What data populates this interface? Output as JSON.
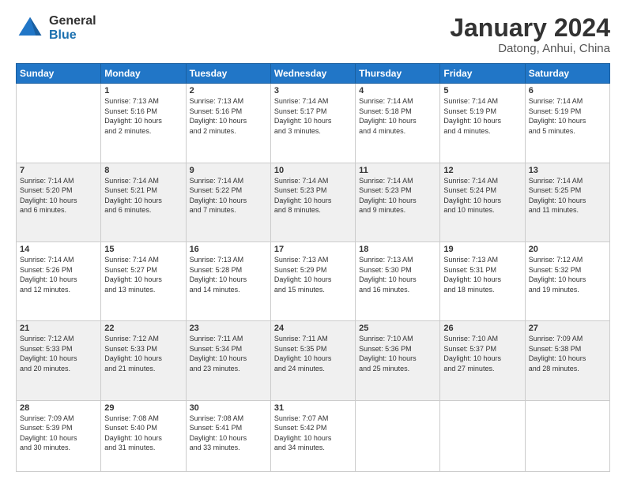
{
  "logo": {
    "general": "General",
    "blue": "Blue"
  },
  "title": {
    "month": "January 2024",
    "location": "Datong, Anhui, China"
  },
  "weekdays": [
    "Sunday",
    "Monday",
    "Tuesday",
    "Wednesday",
    "Thursday",
    "Friday",
    "Saturday"
  ],
  "weeks": [
    [
      {
        "day": "",
        "info": ""
      },
      {
        "day": "1",
        "info": "Sunrise: 7:13 AM\nSunset: 5:16 PM\nDaylight: 10 hours\nand 2 minutes."
      },
      {
        "day": "2",
        "info": "Sunrise: 7:13 AM\nSunset: 5:16 PM\nDaylight: 10 hours\nand 2 minutes."
      },
      {
        "day": "3",
        "info": "Sunrise: 7:14 AM\nSunset: 5:17 PM\nDaylight: 10 hours\nand 3 minutes."
      },
      {
        "day": "4",
        "info": "Sunrise: 7:14 AM\nSunset: 5:18 PM\nDaylight: 10 hours\nand 4 minutes."
      },
      {
        "day": "5",
        "info": "Sunrise: 7:14 AM\nSunset: 5:19 PM\nDaylight: 10 hours\nand 4 minutes."
      },
      {
        "day": "6",
        "info": "Sunrise: 7:14 AM\nSunset: 5:19 PM\nDaylight: 10 hours\nand 5 minutes."
      }
    ],
    [
      {
        "day": "7",
        "info": "Sunrise: 7:14 AM\nSunset: 5:20 PM\nDaylight: 10 hours\nand 6 minutes."
      },
      {
        "day": "8",
        "info": "Sunrise: 7:14 AM\nSunset: 5:21 PM\nDaylight: 10 hours\nand 6 minutes."
      },
      {
        "day": "9",
        "info": "Sunrise: 7:14 AM\nSunset: 5:22 PM\nDaylight: 10 hours\nand 7 minutes."
      },
      {
        "day": "10",
        "info": "Sunrise: 7:14 AM\nSunset: 5:23 PM\nDaylight: 10 hours\nand 8 minutes."
      },
      {
        "day": "11",
        "info": "Sunrise: 7:14 AM\nSunset: 5:23 PM\nDaylight: 10 hours\nand 9 minutes."
      },
      {
        "day": "12",
        "info": "Sunrise: 7:14 AM\nSunset: 5:24 PM\nDaylight: 10 hours\nand 10 minutes."
      },
      {
        "day": "13",
        "info": "Sunrise: 7:14 AM\nSunset: 5:25 PM\nDaylight: 10 hours\nand 11 minutes."
      }
    ],
    [
      {
        "day": "14",
        "info": "Sunrise: 7:14 AM\nSunset: 5:26 PM\nDaylight: 10 hours\nand 12 minutes."
      },
      {
        "day": "15",
        "info": "Sunrise: 7:14 AM\nSunset: 5:27 PM\nDaylight: 10 hours\nand 13 minutes."
      },
      {
        "day": "16",
        "info": "Sunrise: 7:13 AM\nSunset: 5:28 PM\nDaylight: 10 hours\nand 14 minutes."
      },
      {
        "day": "17",
        "info": "Sunrise: 7:13 AM\nSunset: 5:29 PM\nDaylight: 10 hours\nand 15 minutes."
      },
      {
        "day": "18",
        "info": "Sunrise: 7:13 AM\nSunset: 5:30 PM\nDaylight: 10 hours\nand 16 minutes."
      },
      {
        "day": "19",
        "info": "Sunrise: 7:13 AM\nSunset: 5:31 PM\nDaylight: 10 hours\nand 18 minutes."
      },
      {
        "day": "20",
        "info": "Sunrise: 7:12 AM\nSunset: 5:32 PM\nDaylight: 10 hours\nand 19 minutes."
      }
    ],
    [
      {
        "day": "21",
        "info": "Sunrise: 7:12 AM\nSunset: 5:33 PM\nDaylight: 10 hours\nand 20 minutes."
      },
      {
        "day": "22",
        "info": "Sunrise: 7:12 AM\nSunset: 5:33 PM\nDaylight: 10 hours\nand 21 minutes."
      },
      {
        "day": "23",
        "info": "Sunrise: 7:11 AM\nSunset: 5:34 PM\nDaylight: 10 hours\nand 23 minutes."
      },
      {
        "day": "24",
        "info": "Sunrise: 7:11 AM\nSunset: 5:35 PM\nDaylight: 10 hours\nand 24 minutes."
      },
      {
        "day": "25",
        "info": "Sunrise: 7:10 AM\nSunset: 5:36 PM\nDaylight: 10 hours\nand 25 minutes."
      },
      {
        "day": "26",
        "info": "Sunrise: 7:10 AM\nSunset: 5:37 PM\nDaylight: 10 hours\nand 27 minutes."
      },
      {
        "day": "27",
        "info": "Sunrise: 7:09 AM\nSunset: 5:38 PM\nDaylight: 10 hours\nand 28 minutes."
      }
    ],
    [
      {
        "day": "28",
        "info": "Sunrise: 7:09 AM\nSunset: 5:39 PM\nDaylight: 10 hours\nand 30 minutes."
      },
      {
        "day": "29",
        "info": "Sunrise: 7:08 AM\nSunset: 5:40 PM\nDaylight: 10 hours\nand 31 minutes."
      },
      {
        "day": "30",
        "info": "Sunrise: 7:08 AM\nSunset: 5:41 PM\nDaylight: 10 hours\nand 33 minutes."
      },
      {
        "day": "31",
        "info": "Sunrise: 7:07 AM\nSunset: 5:42 PM\nDaylight: 10 hours\nand 34 minutes."
      },
      {
        "day": "",
        "info": ""
      },
      {
        "day": "",
        "info": ""
      },
      {
        "day": "",
        "info": ""
      }
    ]
  ]
}
